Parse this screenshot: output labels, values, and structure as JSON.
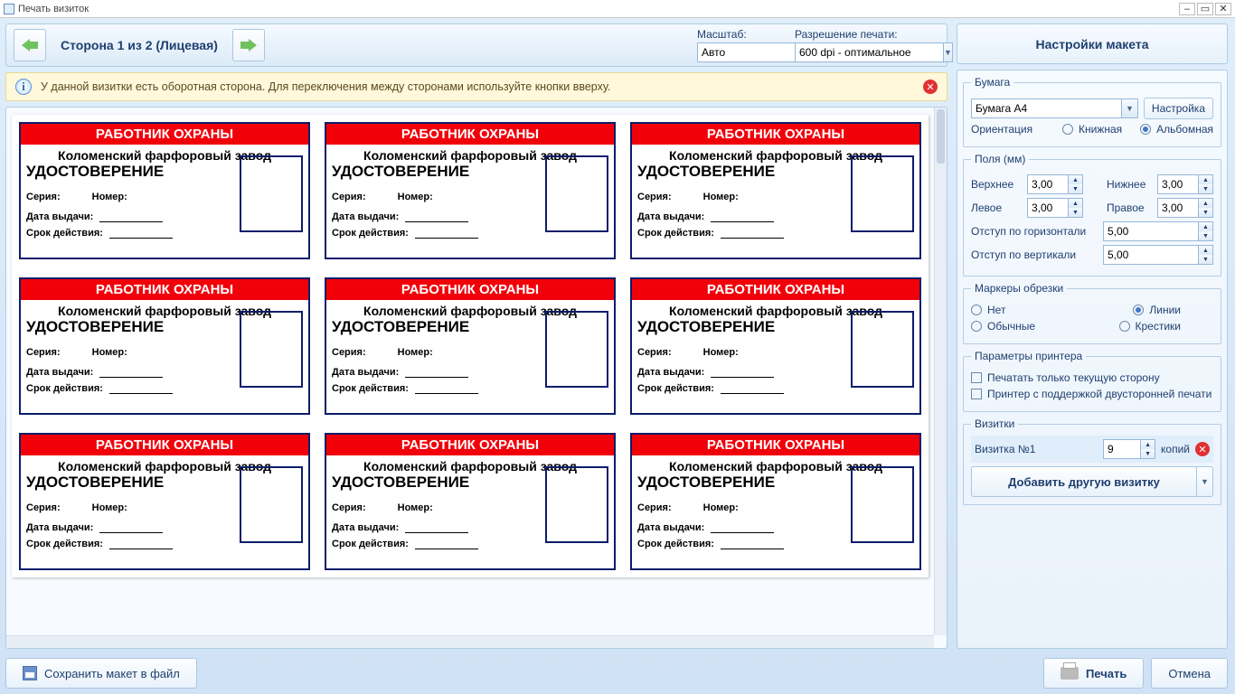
{
  "window": {
    "title": "Печать визиток"
  },
  "toolbar": {
    "page_label": "Сторона 1 из 2 (Лицевая)",
    "scale_label": "Масштаб:",
    "scale_value": "Авто",
    "dpi_label": "Разрешение печати:",
    "dpi_value": "600 dpi - оптимальное"
  },
  "info": {
    "text": "У данной визитки есть оборотная сторона. Для переключения между сторонами используйте кнопки вверху."
  },
  "card": {
    "header": "РАБОТНИК ОХРАНЫ",
    "factory": "Коломенский фарфоровый завод",
    "title": "УДОСТОВЕРЕНИЕ",
    "series_label": "Серия:",
    "number_label": "Номер:",
    "issued_label": "Дата выдачи:",
    "valid_label": "Срок действия:"
  },
  "side": {
    "header": "Настройки макета",
    "paper": {
      "legend": "Бумага",
      "value": "Бумага А4",
      "config_btn": "Настройка",
      "orient_label": "Ориентация",
      "portrait": "Книжная",
      "landscape": "Альбомная"
    },
    "margins": {
      "legend": "Поля (мм)",
      "top_label": "Верхнее",
      "top": "3,00",
      "bottom_label": "Нижнее",
      "bottom": "3,00",
      "left_label": "Левое",
      "left": "3,00",
      "right_label": "Правое",
      "right": "3,00",
      "hpad_label": "Отступ по горизонтали",
      "hpad": "5,00",
      "vpad_label": "Отступ по вертикали",
      "vpad": "5,00"
    },
    "crop": {
      "legend": "Маркеры обрезки",
      "none": "Нет",
      "normal": "Обычные",
      "lines": "Линии",
      "cross": "Крестики"
    },
    "printer": {
      "legend": "Параметры принтера",
      "current_only": "Печатать только текущую сторону",
      "duplex": "Принтер с поддержкой двусторонней печати"
    },
    "cards": {
      "legend": "Визитки",
      "item_label": "Визитка №1",
      "copies": "9",
      "copies_label": "копий",
      "add_btn": "Добавить другую визитку"
    }
  },
  "footer": {
    "save": "Сохранить макет в файл",
    "print": "Печать",
    "cancel": "Отмена"
  }
}
